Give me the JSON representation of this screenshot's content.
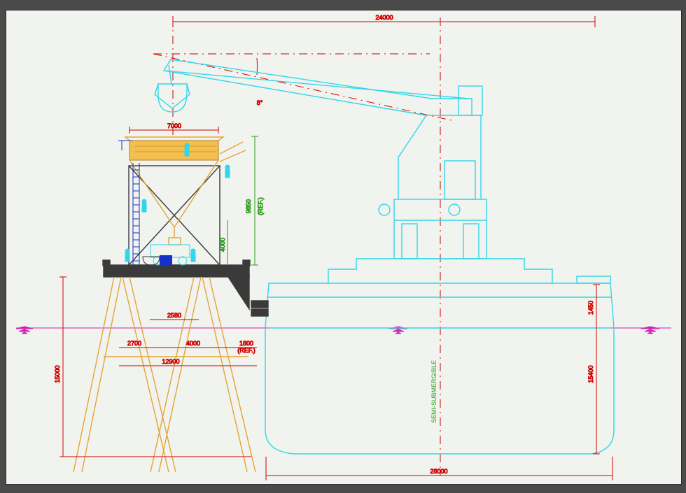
{
  "dimensions": {
    "top_span": "24000",
    "hopper_width": "7000",
    "dock_span": "2580",
    "pile1": "2700",
    "pile2": "4000",
    "pile3": "1800",
    "pile_ref": "(REF.)",
    "pile_total": "12900",
    "vessel_span": "28000",
    "hopper_height": "9850",
    "hopper_ref": "(REF.)",
    "hopper_lower": "4000",
    "pile_height": "15000",
    "hull_depth": "15400",
    "boom_angle": "8°",
    "vessel_note": "SEMI-SUBMERGIBLE",
    "freeboard": "1450"
  }
}
